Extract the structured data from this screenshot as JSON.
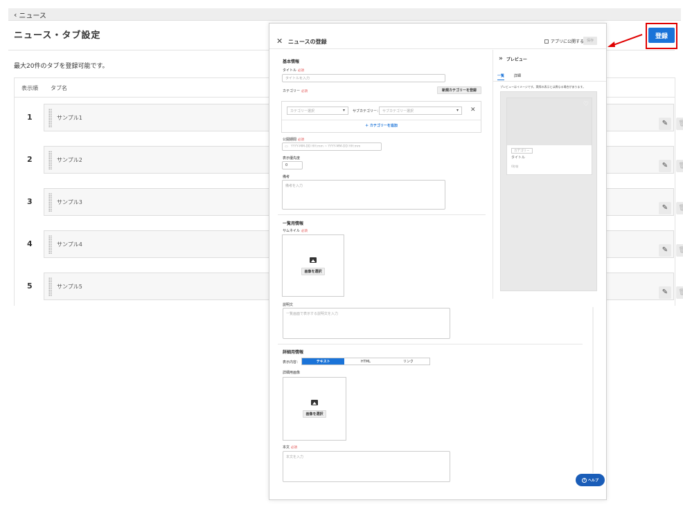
{
  "background": {
    "back_label": "ニュース",
    "page_title": "ニュース・タブ設定",
    "description": "最大20件のタブを登録可能です。",
    "columns": {
      "order": "表示順",
      "name": "タブ名"
    },
    "rows": [
      {
        "num": "1",
        "name": "サンプル1"
      },
      {
        "num": "2",
        "name": "サンプル2"
      },
      {
        "num": "3",
        "name": "サンプル3"
      },
      {
        "num": "4",
        "name": "サンプル4"
      },
      {
        "num": "5",
        "name": "サンプル5"
      }
    ],
    "register_label": "登録"
  },
  "modal": {
    "title": "ニュースの登録",
    "publish_label": "アプリに公開する",
    "save_label": "保存",
    "basic": {
      "section": "基本情報",
      "title_label": "タイトル",
      "required": "必須",
      "title_placeholder": "タイトルを入力",
      "category_label": "カテゴリー",
      "new_category_button": "新規カテゴリーを登録",
      "category_placeholder": "カテゴリー選択",
      "subcategory_label": "サブカテゴリー：",
      "subcategory_placeholder": "サブカテゴリー選択",
      "add_category": "カテゴリーを追加",
      "publish_period_label": "公開期間",
      "publish_period_placeholder": "YYYY-MM-DD HH:mm ~ YYYY-MM-DD HH:mm",
      "priority_label": "表示優先度",
      "priority_value": "0",
      "memo_label": "備考",
      "memo_placeholder": "備考を入力"
    },
    "list": {
      "section": "一覧用情報",
      "thumbnail_label": "サムネイル",
      "select_image": "画像を選択",
      "desc_label": "説明文",
      "desc_placeholder": "一覧画面で表示する説明文を入力"
    },
    "detail": {
      "section": "詳細用情報",
      "display_label": "表示内容：",
      "segments": [
        "テキスト",
        "HTML",
        "リンク"
      ],
      "detail_image_label": "詳細用画像",
      "select_image": "画像を選択",
      "body_label": "本文",
      "body_placeholder": "本文を入力"
    },
    "preview": {
      "title": "プレビュー",
      "tabs": [
        "一覧",
        "詳細"
      ],
      "note": "プレビューはイメージです。実際の表示とは異なる場合があります。",
      "card_category": "カテゴリー",
      "card_title": "タイトル",
      "card_time": "0秒前",
      "heart_icon": "heart-outline"
    },
    "help_label": "ヘルプ"
  },
  "colors": {
    "accent": "#1a73d8",
    "highlight": "#e00000",
    "required": "#e05050"
  }
}
